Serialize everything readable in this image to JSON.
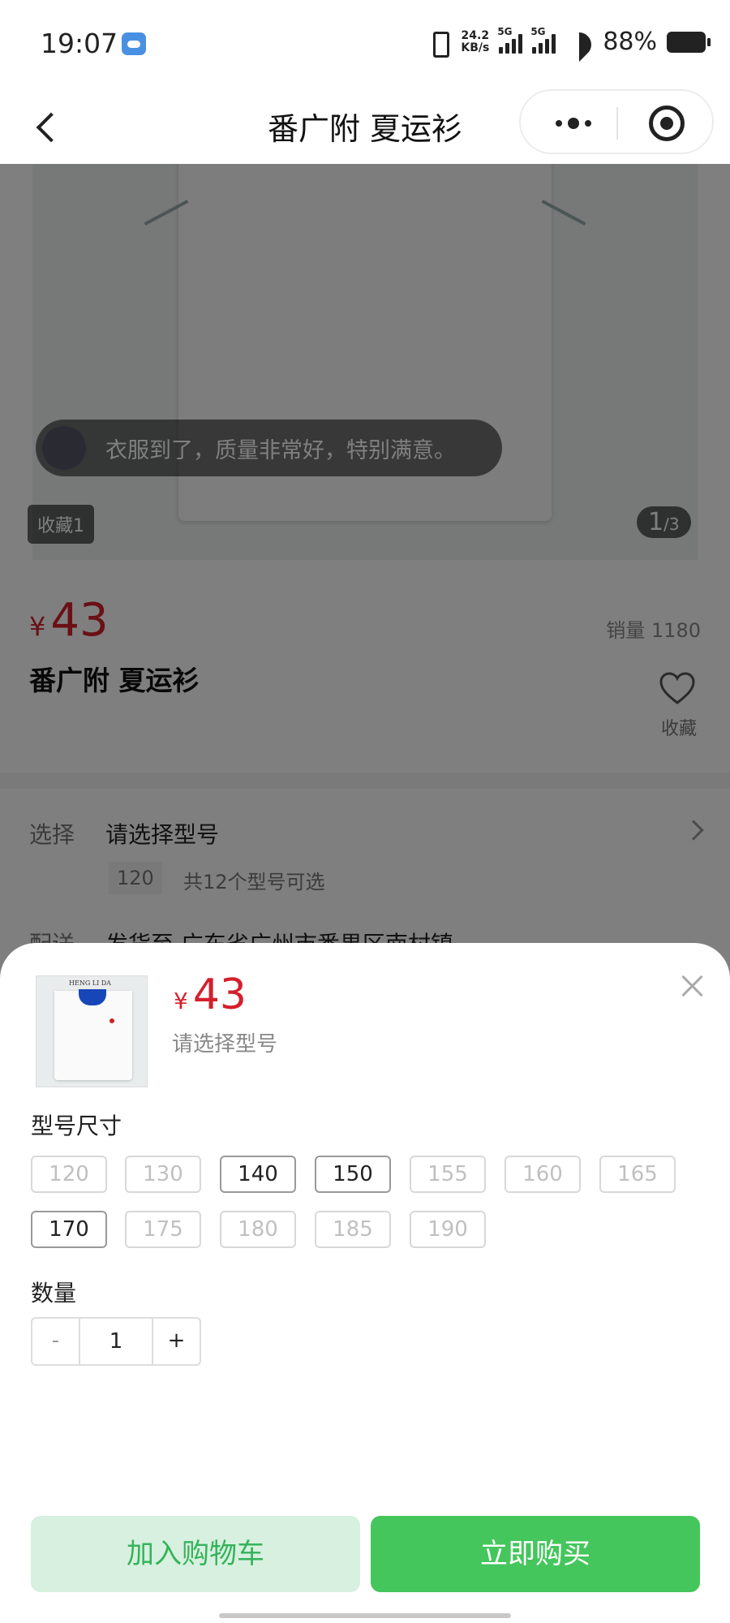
{
  "status_bar": {
    "time": "19:07",
    "net_speed_value": "24.2",
    "net_speed_unit": "KB/s",
    "sim1_label": "5G",
    "sim2_label": "5G",
    "battery": "88%"
  },
  "nav": {
    "title": "番广附 夏运衫"
  },
  "product": {
    "review_text": "衣服到了，质量非常好，特别满意。",
    "favorite_count_label": "收藏1",
    "image_index_current": "1",
    "image_index_total": "/3",
    "currency": "¥",
    "price": "43",
    "sales_label": "销量 1180",
    "title": "番广附 夏运衫",
    "favorite_label": "收藏",
    "select_label": "选择",
    "select_value": "请选择型号",
    "select_tag": "120",
    "select_note": "共12个型号可选",
    "shipping_label": "配送",
    "shipping_value": "发货至 广东省广州市番禺区南村镇"
  },
  "sheet": {
    "thumb_brand": "HENG LI DA",
    "currency": "¥",
    "price": "43",
    "hint": "请选择型号",
    "size_label": "型号尺寸",
    "sizes": [
      {
        "label": "120",
        "available": false
      },
      {
        "label": "130",
        "available": false
      },
      {
        "label": "140",
        "available": true
      },
      {
        "label": "150",
        "available": true
      },
      {
        "label": "155",
        "available": false
      },
      {
        "label": "160",
        "available": false
      },
      {
        "label": "165",
        "available": false
      },
      {
        "label": "170",
        "available": true
      },
      {
        "label": "175",
        "available": false
      },
      {
        "label": "180",
        "available": false
      },
      {
        "label": "185",
        "available": false
      },
      {
        "label": "190",
        "available": false
      }
    ],
    "quantity_label": "数量",
    "minus": "-",
    "plus": "+",
    "quantity": "1",
    "add_to_cart": "加入购物车",
    "buy_now": "立即购买"
  },
  "colors": {
    "price_red": "#d4202c",
    "buy_green": "#45c65d",
    "cart_green_bg": "#d7f0df",
    "cart_green_text": "#35b35a"
  }
}
